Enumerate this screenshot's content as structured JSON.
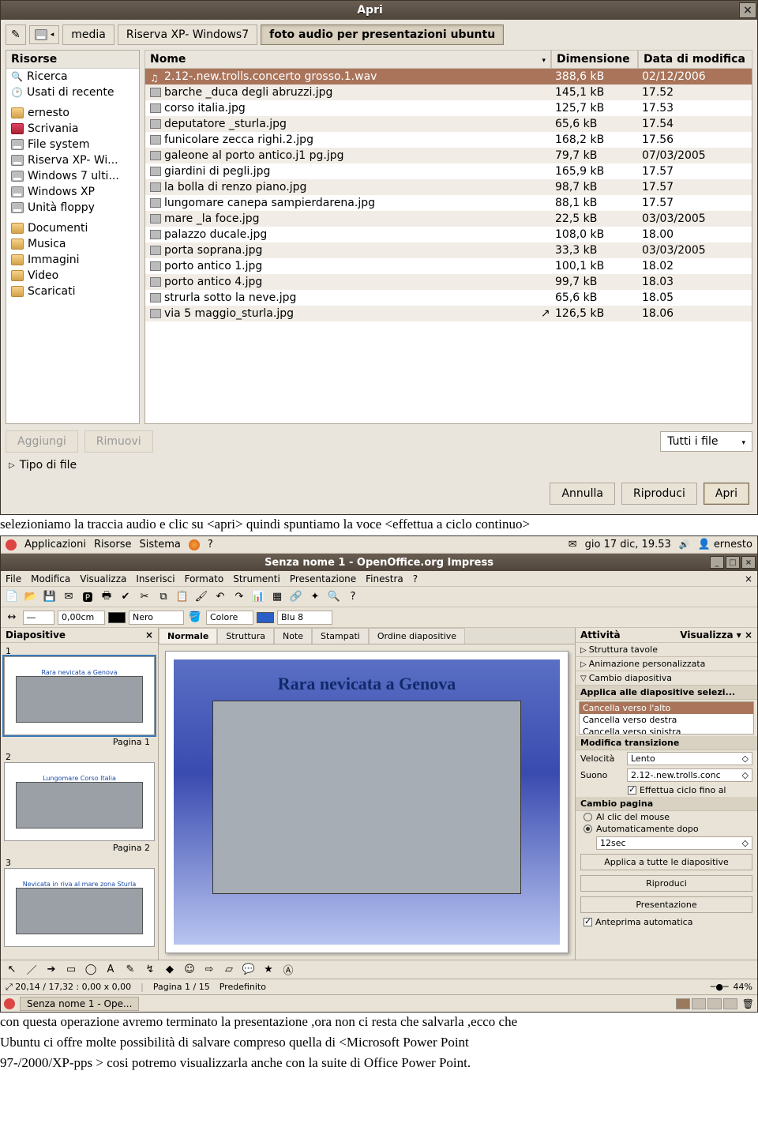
{
  "dialog": {
    "title": "Apri",
    "path_crumbs": [
      "media",
      "Riserva XP- Windows7",
      "foto audio per presentazioni ubuntu"
    ],
    "sidebar_title": "Risorse",
    "sidebar": [
      {
        "icon": "search",
        "label": "Ricerca"
      },
      {
        "icon": "recent",
        "label": "Usati di recente"
      },
      {
        "icon": "folder",
        "label": "ernesto"
      },
      {
        "icon": "folder-red",
        "label": "Scrivania"
      },
      {
        "icon": "disk",
        "label": "File system"
      },
      {
        "icon": "disk",
        "label": "Riserva XP- Wi..."
      },
      {
        "icon": "disk",
        "label": "Windows 7 ulti..."
      },
      {
        "icon": "disk",
        "label": "Windows XP"
      },
      {
        "icon": "disk",
        "label": "Unità floppy"
      },
      {
        "icon": "folder",
        "label": "Documenti"
      },
      {
        "icon": "folder",
        "label": "Musica"
      },
      {
        "icon": "folder",
        "label": "Immagini"
      },
      {
        "icon": "folder",
        "label": "Video"
      },
      {
        "icon": "folder",
        "label": "Scaricati"
      }
    ],
    "columns": {
      "name": "Nome",
      "size": "Dimensione",
      "date": "Data di modifica"
    },
    "files": [
      {
        "icon": "snd",
        "name": "2.12-.new.trolls.concerto grosso.1.wav",
        "size": "388,6 kB",
        "date": "02/12/2006",
        "selected": true
      },
      {
        "icon": "img",
        "name": "barche _duca degli abruzzi.jpg",
        "size": "145,1 kB",
        "date": "17.52"
      },
      {
        "icon": "img",
        "name": "corso italia.jpg",
        "size": "125,7 kB",
        "date": "17.53"
      },
      {
        "icon": "img",
        "name": "deputatore _sturla.jpg",
        "size": "65,6 kB",
        "date": "17.54"
      },
      {
        "icon": "img",
        "name": "funicolare zecca righi.2.jpg",
        "size": "168,2 kB",
        "date": "17.56"
      },
      {
        "icon": "img",
        "name": "galeone al porto antico.j1 pg.jpg",
        "size": "79,7 kB",
        "date": "07/03/2005"
      },
      {
        "icon": "img",
        "name": "giardini di pegli.jpg",
        "size": "165,9 kB",
        "date": "17.57"
      },
      {
        "icon": "img",
        "name": "la bolla di renzo piano.jpg",
        "size": "98,7 kB",
        "date": "17.57"
      },
      {
        "icon": "img",
        "name": "lungomare canepa sampierdarena.jpg",
        "size": "88,1 kB",
        "date": "17.57"
      },
      {
        "icon": "img",
        "name": "mare _la foce.jpg",
        "size": "22,5 kB",
        "date": "03/03/2005"
      },
      {
        "icon": "img",
        "name": "palazzo ducale.jpg",
        "size": "108,0 kB",
        "date": "18.00"
      },
      {
        "icon": "img",
        "name": "porta soprana.jpg",
        "size": "33,3 kB",
        "date": "03/03/2005"
      },
      {
        "icon": "img",
        "name": "porto antico 1.jpg",
        "size": "100,1 kB",
        "date": "18.02"
      },
      {
        "icon": "img",
        "name": "porto antico 4.jpg",
        "size": "99,7 kB",
        "date": "18.03"
      },
      {
        "icon": "img",
        "name": "strurla sotto la neve.jpg",
        "size": "65,6 kB",
        "date": "18.05"
      },
      {
        "icon": "img",
        "name": "via 5 maggio_sturla.jpg",
        "size": "126,5 kB",
        "date": "18.06",
        "cursor": true
      }
    ],
    "buttons": {
      "add": "Aggiungi",
      "remove": "Rimuovi",
      "filetype": "Tipo di file",
      "filter": "Tutti i file",
      "cancel": "Annulla",
      "play": "Riproduci",
      "open": "Apri"
    }
  },
  "prose1": "selezioniamo la traccia audio e clic su <apri>  quindi spuntiamo la voce <effettua a ciclo continuo>",
  "prose2_lines": [
    "con questa operazione avremo terminato la presentazione ,ora non ci resta che salvarla ,ecco che",
    "Ubuntu ci offre molte  possibilità di salvare compreso quella di <Microsoft Power Point",
    "97-/2000/XP-pps > cosi potremo visualizzarla anche con la suite di Office Power Point."
  ],
  "impress": {
    "panel": {
      "apps": "Applicazioni",
      "places": "Risorse",
      "system": "Sistema",
      "clock": "gio 17 dic, 19.53",
      "user": "ernesto"
    },
    "title": "Senza nome 1 - OpenOffice.org Impress",
    "menubar": [
      "File",
      "Modifica",
      "Visualizza",
      "Inserisci",
      "Formato",
      "Strumenti",
      "Presentazione",
      "Finestra",
      "?"
    ],
    "toolbar2": {
      "size": "0,00cm",
      "color1": "Nero",
      "color2_lbl": "Colore",
      "color2": "Blu 8"
    },
    "slidepanel": {
      "title": "Diapositive",
      "slides": [
        {
          "caption": "Rara nevicata a Genova",
          "label": "Pagina 1"
        },
        {
          "caption": "Lungomare Corso Italia",
          "label": "Pagina 2"
        },
        {
          "caption": "Nevicata in riva al mare zona Sturla",
          "label": ""
        }
      ]
    },
    "viewtabs": [
      "Normale",
      "Struttura",
      "Note",
      "Stampati",
      "Ordine diapositive"
    ],
    "slide_title": "Rara nevicata a Genova",
    "taskpane": {
      "title": "Attività",
      "view": "Visualizza",
      "sections": [
        "Struttura tavole",
        "Animazione personalizzata",
        "Cambio diapositiva"
      ],
      "applylbl": "Applica alle diapositive selezi...",
      "effects": [
        "Cancella verso l'alto",
        "Cancella verso destra",
        "Cancella verso sinistra"
      ],
      "modify": "Modifica transizione",
      "speed_lbl": "Velocità",
      "speed": "Lento",
      "sound_lbl": "Suono",
      "sound": "2.12-.new.trolls.conc",
      "loop": "Effettua ciclo fino al",
      "advance": "Cambio pagina",
      "onclick": "Al clic del mouse",
      "auto": "Automaticamente dopo",
      "auto_val": "12sec",
      "apply_all": "Applica a tutte le diapositive",
      "play": "Riproduci",
      "show": "Presentazione",
      "preview": "Anteprima automatica"
    },
    "status": {
      "coords": "20,14 / 17,32 : 0,00 x 0,00",
      "page": "Pagina 1 / 15",
      "layout": "Predefinito",
      "zoom": "44%"
    },
    "taskbar": {
      "task": "Senza nome 1 - Ope..."
    }
  }
}
